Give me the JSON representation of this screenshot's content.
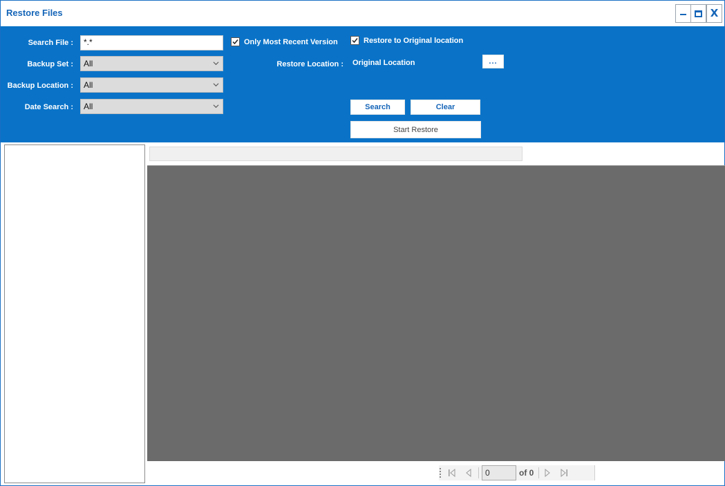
{
  "window": {
    "title": "Restore Files",
    "close_glyph": "X"
  },
  "form": {
    "search_file_label": "Search File :",
    "search_file_value": "*.*",
    "backup_set_label": "Backup Set :",
    "backup_set_value": "All",
    "backup_location_label": "Backup Location :",
    "backup_location_value": "All",
    "date_search_label": "Date Search :",
    "date_search_value": "All",
    "only_recent_label": "Only Most Recent Version",
    "only_recent_checked": true,
    "restore_original_label": "Restore to Original location",
    "restore_original_checked": true,
    "restore_location_label": "Restore Location :",
    "restore_location_value": "Original Location",
    "browse_label": "..."
  },
  "buttons": {
    "search": "Search",
    "clear": "Clear",
    "start_restore": "Start Restore"
  },
  "pager": {
    "current_page": "0",
    "of_label": "of 0"
  },
  "colors": {
    "panel_blue": "#0a73c8",
    "title_blue": "#1565b8",
    "grid_gray": "#6b6b6b"
  }
}
